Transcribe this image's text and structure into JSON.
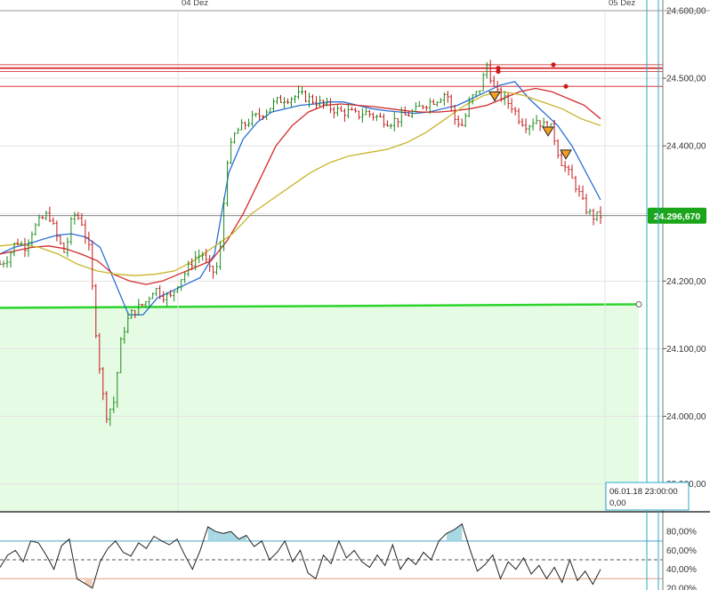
{
  "chart_data": {
    "type": "candlestick",
    "price_axis": {
      "ylim": [
        23860,
        24600
      ],
      "ticks": [
        {
          "value": 24600,
          "label": "24.600,00"
        },
        {
          "value": 24500,
          "label": "24.500,00"
        },
        {
          "value": 24400,
          "label": "24.400,00"
        },
        {
          "value": 24300,
          "label": "24.300,00"
        },
        {
          "value": 24200,
          "label": "24.200,00"
        },
        {
          "value": 24100,
          "label": "24.100,00"
        },
        {
          "value": 24000,
          "label": "24.000,00"
        },
        {
          "value": 23900,
          "label": "23.900,00"
        }
      ]
    },
    "date_labels": [
      "04 Dez",
      "05 Dez"
    ],
    "current_price": {
      "value": 24296.67,
      "label": "24.296,670",
      "color": "#1aa51a"
    },
    "horizontal_levels": [
      {
        "value": 24520,
        "color": "#d01818"
      },
      {
        "value": 24515,
        "color": "#d01818"
      },
      {
        "value": 24510,
        "color": "#d01818"
      },
      {
        "value": 24488,
        "color": "#d01818"
      }
    ],
    "support_zone": {
      "value": 24163,
      "color": "#2bd42b",
      "fill": "#e6fbe4"
    },
    "crosshair_tooltip": {
      "line1": "06.01.18 23:00:00",
      "line2": "0,00"
    },
    "price_series": [
      24225,
      24235,
      24260,
      24250,
      24275,
      24290,
      24300,
      24265,
      24240,
      24300,
      24290,
      24245,
      24100,
      24000,
      24020,
      24120,
      24150,
      24160,
      24170,
      24190,
      24180,
      24175,
      24200,
      24215,
      24235,
      24240,
      24210,
      24225,
      24380,
      24420,
      24430,
      24440,
      24445,
      24455,
      24465,
      24470,
      24472,
      24475,
      24470,
      24465,
      24460,
      24455,
      24450,
      24450,
      24445,
      24450,
      24445,
      24440,
      24435,
      24440,
      24445,
      24450,
      24460,
      24465,
      24470,
      24480,
      24440,
      24430,
      24470,
      24480,
      24520,
      24480,
      24470,
      24460,
      24440,
      24430,
      24440,
      24430,
      24425,
      24380,
      24360,
      24340,
      24310,
      24295,
      24297
    ],
    "moving_averages": [
      {
        "color": "#2a6fd6",
        "values": [
          24240,
          24250,
          24255,
          24262,
          24268,
          24270,
          24265,
          24250,
          24200,
          24150,
          24150,
          24175,
          24185,
          24195,
          24205,
          24240,
          24360,
          24410,
          24435,
          24450,
          24455,
          24460,
          24462,
          24465,
          24465,
          24460,
          24455,
          24452,
          24450,
          24448,
          24450,
          24455,
          24460,
          24470,
          24480,
          24490,
          24495,
          24470,
          24450,
          24430,
          24400,
          24360,
          24320
        ]
      },
      {
        "color": "#d42a2a",
        "values": [
          24240,
          24245,
          24250,
          24252,
          24248,
          24240,
          24230,
          24210,
          24200,
          24195,
          24200,
          24210,
          24220,
          24230,
          24260,
          24300,
          24350,
          24400,
          24430,
          24450,
          24460,
          24462,
          24460,
          24458,
          24455,
          24452,
          24450,
          24450,
          24452,
          24455,
          24460,
          24470,
          24480,
          24485,
          24480,
          24470,
          24460,
          24440
        ]
      },
      {
        "color": "#c8b42a",
        "values": [
          24252,
          24255,
          24250,
          24240,
          24225,
          24215,
          24210,
          24208,
          24210,
          24215,
          24230,
          24250,
          24270,
          24300,
          24320,
          24340,
          24360,
          24375,
          24385,
          24390,
          24395,
          24405,
          24420,
          24440,
          24460,
          24475,
          24480,
          24475,
          24465,
          24455,
          24440,
          24430
        ]
      }
    ],
    "oscillator": {
      "ylim": [
        18,
        100
      ],
      "ticks": [
        {
          "value": 80,
          "label": "80,00%"
        },
        {
          "value": 60,
          "label": "60,00%"
        },
        {
          "value": 40,
          "label": "40,00%"
        },
        {
          "value": 20,
          "label": "20,00%"
        }
      ],
      "upper_band": 70,
      "mid_band": 50,
      "lower_band": 30,
      "values": [
        42,
        55,
        60,
        48,
        70,
        68,
        55,
        40,
        65,
        72,
        30,
        25,
        20,
        48,
        62,
        70,
        58,
        54,
        68,
        62,
        75,
        70,
        66,
        72,
        55,
        40,
        60,
        85,
        80,
        78,
        80,
        72,
        76,
        64,
        70,
        50,
        58,
        70,
        48,
        60,
        36,
        30,
        55,
        46,
        70,
        52,
        60,
        48,
        42,
        55,
        44,
        66,
        40,
        52,
        45,
        58,
        50,
        70,
        78,
        82,
        88,
        62,
        38,
        45,
        55,
        30,
        48,
        40,
        52,
        35,
        44,
        30,
        42,
        26,
        50,
        28,
        38,
        24,
        40
      ]
    }
  }
}
